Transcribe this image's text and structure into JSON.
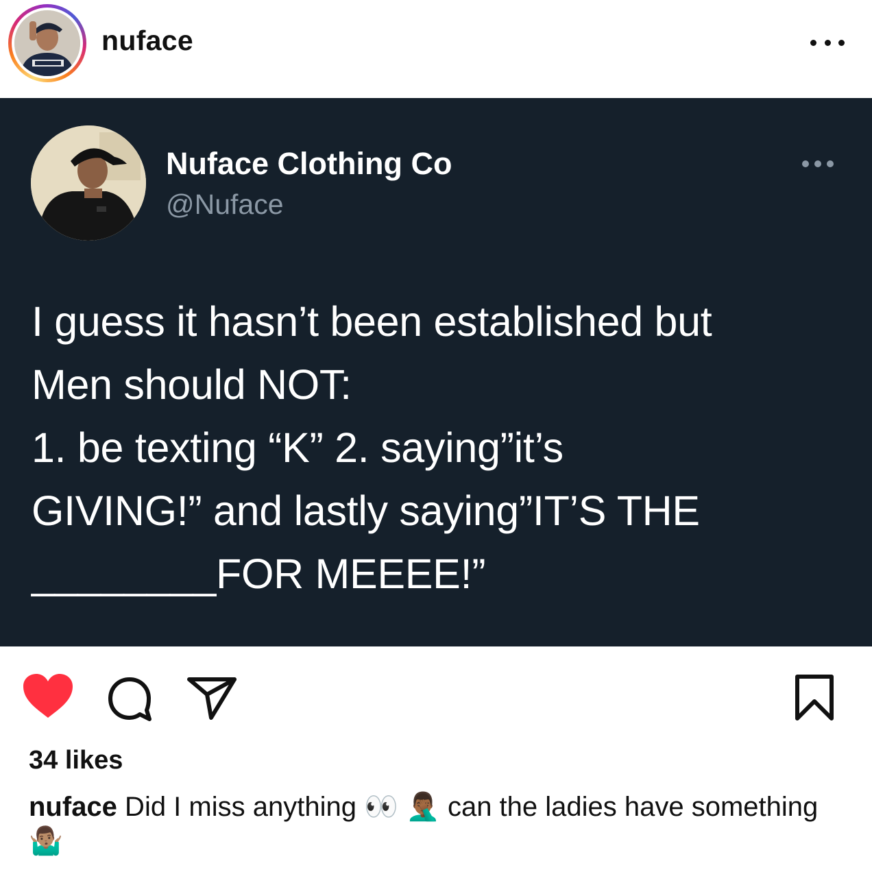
{
  "header": {
    "username": "nuface"
  },
  "tweet": {
    "display_name": "Nuface Clothing Co",
    "handle": "@Nuface",
    "text": "I guess it hasn’t been established but\nMen should NOT:\n1. be texting “K” 2. saying”it’s\nGIVING!” and lastly saying”IT’S THE\n________FOR MEEEE!”"
  },
  "actions": {
    "liked": true,
    "heart_color": "#ff3040"
  },
  "likes": "34 likes",
  "caption": {
    "username": "nuface",
    "text_part1": " Did I miss anything ",
    "emoji1": "👀",
    "emoji2": "🤦🏾‍♂️",
    "text_part2": " can the ladies have something ",
    "emoji3": "🤷🏽‍♂️"
  },
  "colors": {
    "tweet_background": "#15202b",
    "tweet_handle": "#8b98a5"
  }
}
